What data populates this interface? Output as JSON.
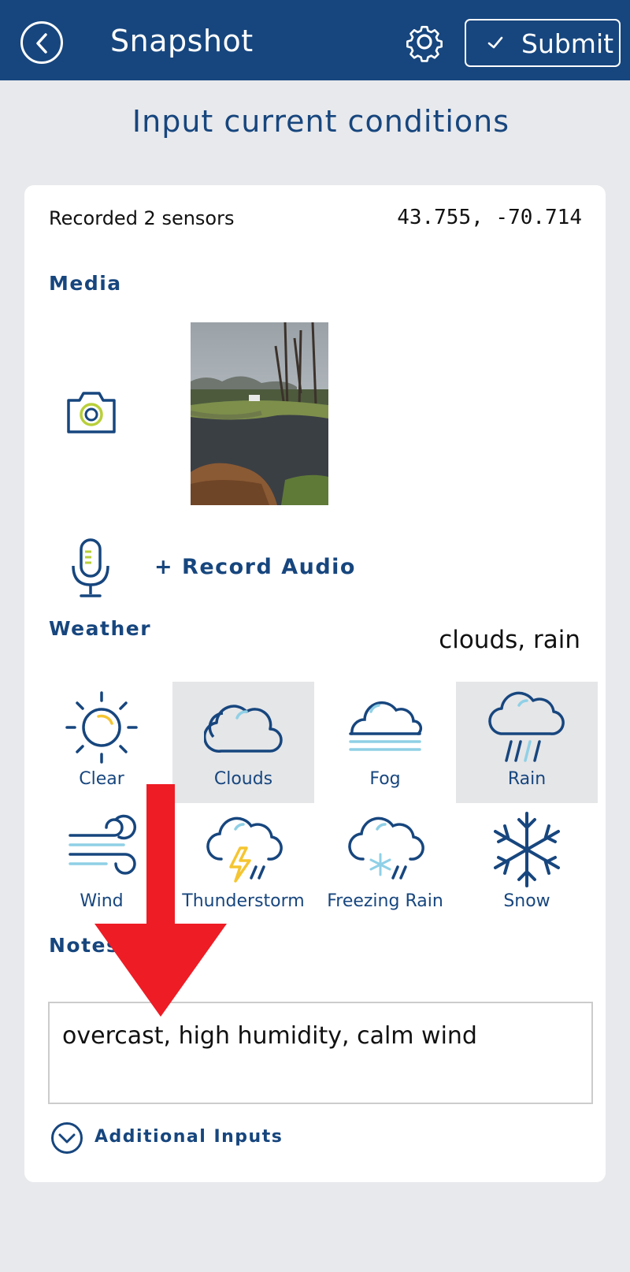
{
  "header": {
    "title": "Snapshot",
    "submit_label": "Submit",
    "back_icon": "chevron-left-circle-icon",
    "settings_icon": "gear-icon",
    "submit_icon": "check-icon"
  },
  "page_heading": "Input current conditions",
  "card": {
    "sensors_text": "Recorded 2 sensors",
    "coordinates": "43.755, -70.714",
    "media": {
      "label": "Media",
      "camera_icon": "camera-icon",
      "mic_icon": "microphone-icon",
      "record_audio_label": "+ Record Audio"
    },
    "weather": {
      "label": "Weather",
      "summary": "clouds, rain",
      "options": [
        {
          "label": "Clear",
          "icon": "sun-icon",
          "selected": false
        },
        {
          "label": "Clouds",
          "icon": "cloud-icon",
          "selected": true
        },
        {
          "label": "Fog",
          "icon": "fog-icon",
          "selected": false
        },
        {
          "label": "Rain",
          "icon": "rain-icon",
          "selected": true
        },
        {
          "label": "Wind",
          "icon": "wind-icon",
          "selected": false
        },
        {
          "label": "Thunderstorm",
          "icon": "thunderstorm-icon",
          "selected": false
        },
        {
          "label": "Freezing Rain",
          "icon": "freezing-rain-icon",
          "selected": false
        },
        {
          "label": "Snow",
          "icon": "snowflake-icon",
          "selected": false
        }
      ]
    },
    "notes": {
      "label": "Notes",
      "value": "overcast, high humidity, calm wind"
    },
    "additional_inputs_label": "Additional Inputs"
  },
  "colors": {
    "header_bg": "#17467e",
    "primary": "#17467e",
    "page_bg": "#e8e9ec",
    "accent_light_blue": "#8fd0e6",
    "accent_yellow": "#f5c531",
    "selected_bg": "#e5e6e8",
    "annotation_arrow": "#ee1c25"
  }
}
